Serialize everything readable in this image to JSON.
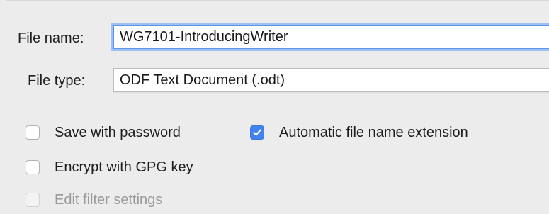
{
  "file_name": {
    "label": "File name:",
    "value": "WG7101-IntroducingWriter"
  },
  "file_type": {
    "label": "File type:",
    "value": "ODF Text Document (.odt)"
  },
  "options": {
    "save_with_password": {
      "label": "Save with password",
      "checked": false,
      "enabled": true
    },
    "automatic_extension": {
      "label": "Automatic file name extension",
      "checked": true,
      "enabled": true
    },
    "encrypt_gpg": {
      "label": "Encrypt with GPG key",
      "checked": false,
      "enabled": true
    },
    "edit_filter": {
      "label": "Edit filter settings",
      "checked": false,
      "enabled": false
    }
  },
  "colors": {
    "accent": "#3f82f0",
    "focus_ring": "#9dc0f4",
    "background": "#ececec"
  },
  "icons": {
    "checkmark": "checkmark-icon"
  }
}
